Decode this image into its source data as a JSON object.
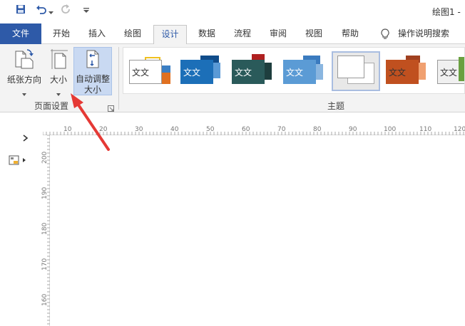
{
  "window": {
    "title": "绘图1 -"
  },
  "qat": {
    "save_icon": "save-icon",
    "undo_icon": "undo-icon",
    "redo_icon": "redo-icon",
    "customize_icon": "customize-icon"
  },
  "tabs": [
    {
      "label": "文件"
    },
    {
      "label": "开始"
    },
    {
      "label": "插入"
    },
    {
      "label": "绘图"
    },
    {
      "label": "设计"
    },
    {
      "label": "数据"
    },
    {
      "label": "流程"
    },
    {
      "label": "审阅"
    },
    {
      "label": "视图"
    },
    {
      "label": "帮助"
    }
  ],
  "tell_me": {
    "label": "操作说明搜索"
  },
  "page_setup": {
    "orientation_line1": "纸张方向",
    "size_line1": "大小",
    "autofit_line1": "自动调整",
    "autofit_line2": "大小",
    "group_label": "页面设置"
  },
  "themes": {
    "group_label": "主题",
    "items": [
      {
        "text": "文文",
        "bg": "#ffffff",
        "c1": "#f0c020",
        "c2": "#3b7fc4",
        "c3": "#e07020",
        "text_color": "#333333"
      },
      {
        "text": "文文",
        "bg": "#1c6fb8",
        "c1": "#1c6fb8",
        "c2": "#104c8a",
        "c3": "#5a9ad6",
        "text_color": "#ffffff"
      },
      {
        "text": "文文",
        "bg": "#2a5a5a",
        "c1": "#b02020",
        "c2": "#3a6e6e",
        "c3": "#1e3e3e",
        "text_color": "#ffffff"
      },
      {
        "text": "文文",
        "bg": "#5b9bd5",
        "c1": "#8ab6e0",
        "c2": "#3b7bbf",
        "c3": "#2e6aa8",
        "text_color": "#ffffff"
      },
      {
        "text": "",
        "bg": "#ffffff",
        "c1": "#ffffff",
        "c2": "#eeeeee",
        "c3": "#cccccc",
        "text_color": "#333333"
      },
      {
        "text": "文文",
        "bg": "#c0501f",
        "c1": "#e07040",
        "c2": "#a04020",
        "c3": "#f0a070",
        "text_color": "#333333"
      },
      {
        "text": "文文",
        "bg": "#f0f0f0",
        "c1": "#d0e0a0",
        "c2": "#6aa040",
        "c3": "#b0b0b0",
        "text_color": "#333333"
      }
    ]
  },
  "hruler": {
    "labels": [
      "10",
      "20",
      "30",
      "40",
      "50",
      "60",
      "70",
      "80",
      "90",
      "100",
      "110",
      "120"
    ]
  },
  "vruler": {
    "labels": [
      "200",
      "190",
      "180",
      "170",
      "160"
    ]
  },
  "accent": "#2e5aa8",
  "arrow_color": "#e53935"
}
